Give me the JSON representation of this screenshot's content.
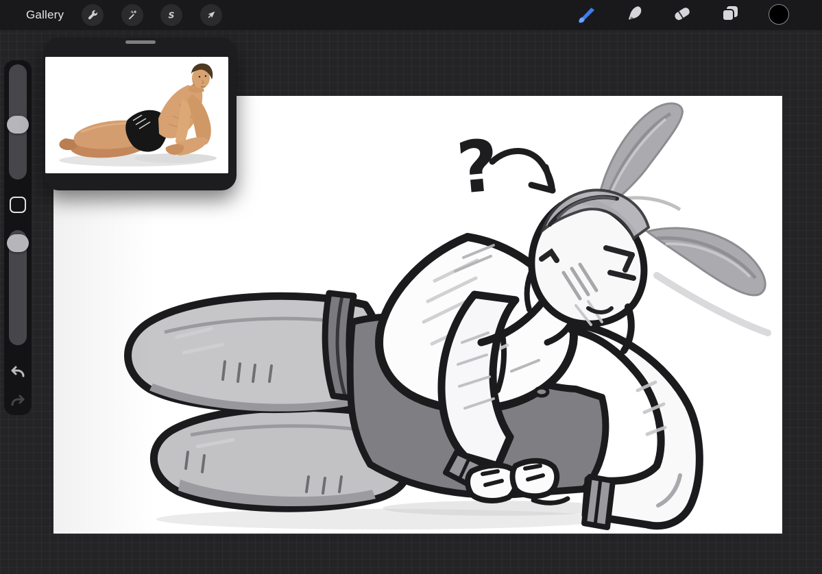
{
  "header": {
    "gallery_label": "Gallery",
    "accent_color": "#3b7df2",
    "left_tools": [
      {
        "label": "actions",
        "icon": "wrench-icon"
      },
      {
        "label": "adjustments",
        "icon": "magic-wand-icon"
      },
      {
        "label": "selection",
        "icon": "selection-s-icon"
      },
      {
        "label": "transform",
        "icon": "transform-arrow-icon"
      }
    ],
    "right_tools": [
      {
        "label": "paint",
        "icon": "brush-icon",
        "active": true,
        "color": "#3b7df2"
      },
      {
        "label": "smudge",
        "icon": "smudge-icon",
        "active": false
      },
      {
        "label": "erase",
        "icon": "eraser-icon",
        "active": false
      },
      {
        "label": "layers",
        "icon": "layers-icon",
        "active": false
      },
      {
        "label": "color",
        "icon": "color-swatch-circle",
        "value": "#000000"
      }
    ]
  },
  "sidebar": {
    "brush_size_thumb_percent": 53,
    "opacity_thumb_percent": 4,
    "buttons": [
      "brush-size-slider",
      "modify-button",
      "opacity-slider",
      "undo-button",
      "redo-button"
    ]
  },
  "reference_window": {
    "kind": "floating-reference-panel",
    "photo_description": "man in black trunks reclining on side, propped on elbow, white backdrop",
    "has_drag_handle": true
  },
  "canvas": {
    "annotation": "?",
    "sketch_description": "grayscale sketch of muscular figure with bunny ears lying on side, thigh-high stockings, wristbands, hands clasped",
    "paper_color": "#ffffff"
  }
}
